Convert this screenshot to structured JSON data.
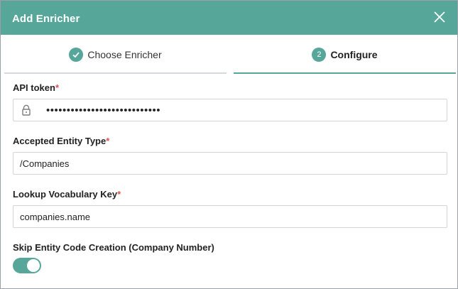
{
  "dialog": {
    "title": "Add Enricher"
  },
  "steps": [
    {
      "label": "Choose Enricher",
      "status": "completed",
      "badge_icon": "check-icon"
    },
    {
      "label": "Configure",
      "status": "active",
      "badge_number": "2"
    }
  ],
  "form": {
    "api_token": {
      "label": "API token",
      "required_mark": "*",
      "value": "••••••••••••••••••••••••••••"
    },
    "accepted_entity_type": {
      "label": "Accepted Entity Type",
      "required_mark": "*",
      "value": "/Companies"
    },
    "lookup_vocabulary_key": {
      "label": "Lookup Vocabulary Key",
      "required_mark": "*",
      "value": "companies.name"
    },
    "skip_entity_code_creation": {
      "label": "Skip Entity Code Creation (Company Number)",
      "enabled": true
    }
  },
  "colors": {
    "accent": "#56a69a",
    "required": "#d9534f"
  }
}
